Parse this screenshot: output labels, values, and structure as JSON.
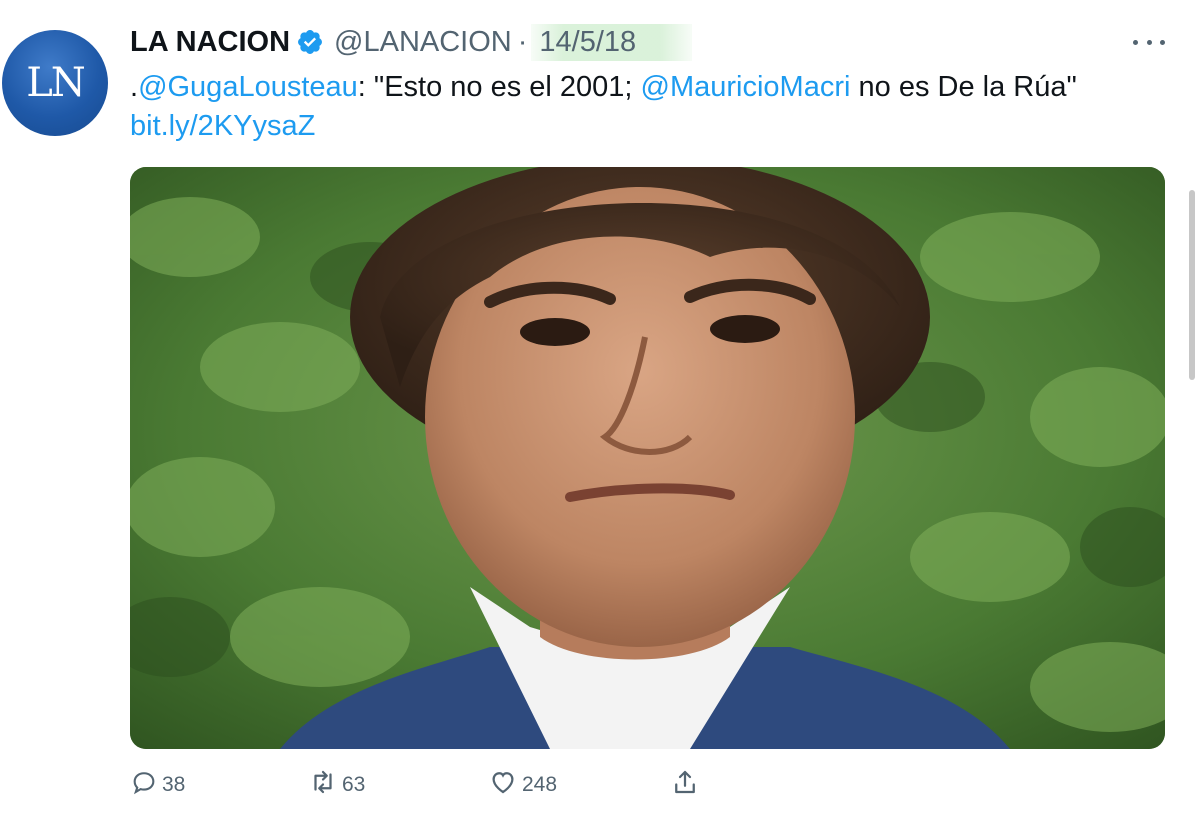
{
  "tweet": {
    "avatar_text": "LN",
    "display_name": "LA NACION",
    "handle": "@LANACION",
    "separator": "·",
    "date": "14/5/18",
    "text_prefix": ".",
    "mention_1": "@GugaLousteau",
    "text_mid_1": ": \"Esto no es el 2001; ",
    "mention_2": "@MauricioMacri",
    "text_mid_2": " no es De la Rúa\" ",
    "link": "bit.ly/2KYysaZ"
  },
  "actions": {
    "replies": "38",
    "retweets": "63",
    "likes": "248"
  },
  "colors": {
    "accent": "#1d9bf0",
    "text": "#0f1419",
    "muted": "#536471",
    "avatar": "#1f59a8"
  },
  "icons": [
    "verified-icon",
    "more-icon",
    "reply-icon",
    "retweet-icon",
    "like-icon",
    "share-icon"
  ]
}
